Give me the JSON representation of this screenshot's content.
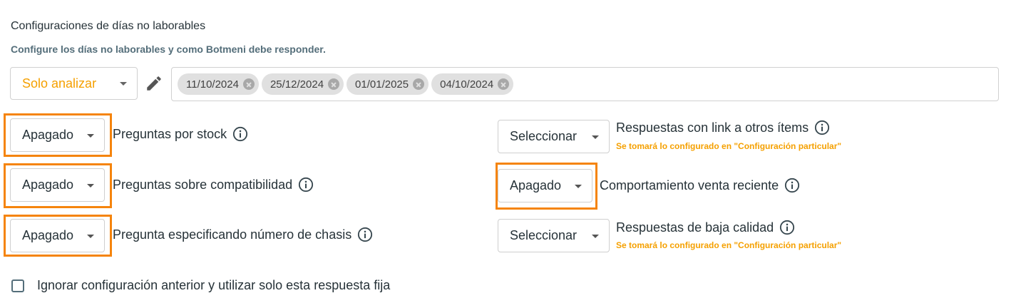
{
  "header": {
    "title": "Configuraciones de días no laborables",
    "subtitle": "Configure los días no laborables y como Botmeni debe responder."
  },
  "mode": {
    "value": "Solo analizar"
  },
  "dates": [
    "11/10/2024",
    "25/12/2024",
    "01/01/2025",
    "04/10/2024"
  ],
  "rows": {
    "stock": {
      "value": "Apagado",
      "label": "Preguntas por stock"
    },
    "compat": {
      "value": "Apagado",
      "label": "Preguntas sobre compatibilidad"
    },
    "chasis": {
      "value": "Apagado",
      "label": "Pregunta especificando número de chasis"
    },
    "links": {
      "value": "Seleccionar",
      "label": "Respuestas con link a otros ítems",
      "note": "Se tomará lo configurado en \"Configuración particular\""
    },
    "venta": {
      "value": "Apagado",
      "label": "Comportamiento venta reciente"
    },
    "baja": {
      "value": "Seleccionar",
      "label": "Respuestas de baja calidad",
      "note": "Se tomará lo configurado en \"Configuración particular\""
    }
  },
  "checkbox": {
    "label": "Ignorar configuración anterior y utilizar solo esta respuesta fija",
    "checked": false
  },
  "colors": {
    "accent": "#f5a000",
    "highlight": "#f5840c"
  }
}
